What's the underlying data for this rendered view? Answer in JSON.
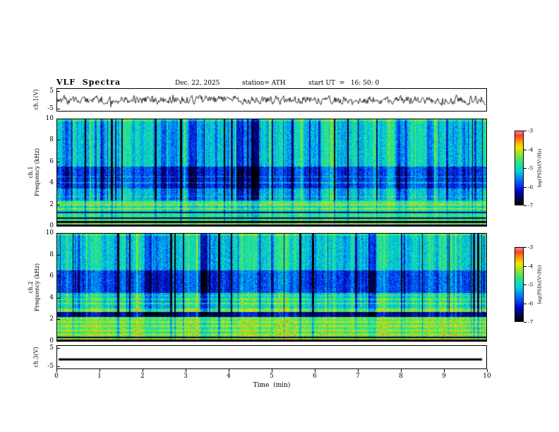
{
  "colors": {
    "background": "#ffffff",
    "ink": "#000000"
  },
  "header": {
    "title": "VLF  Spectra",
    "date": "Dec. 22, 2025",
    "station": "station= ATH",
    "start_ut": "start UT  =   16: 50: 0"
  },
  "panels": {
    "ch1_wave": {
      "label": "ch.1(V)",
      "ymax": "5",
      "ymin": "-5"
    },
    "ch1_spec": {
      "label_line1": "ch.1",
      "label_line2": "Frequency  (kHz)",
      "yticks": [
        "10",
        "8",
        "6",
        "4",
        "2",
        "0"
      ]
    },
    "ch2_spec": {
      "label_line1": "ch.2",
      "label_line2": "Frequency  (kHz)",
      "yticks": [
        "10",
        "8",
        "6",
        "4",
        "2",
        "0"
      ]
    },
    "ch3_wave": {
      "label": "ch.3(V)",
      "ymax": "5",
      "ymin": "-5"
    }
  },
  "xaxis": {
    "label": "Time  (min)",
    "ticks": [
      "0",
      "1",
      "2",
      "3",
      "4",
      "5",
      "6",
      "7",
      "8",
      "9",
      "10"
    ]
  },
  "colorbar": {
    "label": "log(PSD)/(V²/Hz)",
    "ticks": [
      "-3",
      "-4",
      "-5",
      "-6",
      "-7"
    ],
    "gradient": [
      {
        "t": 0.0,
        "hex": "#000000"
      },
      {
        "t": 0.08,
        "hex": "#04044a"
      },
      {
        "t": 0.18,
        "hex": "#0000c8"
      },
      {
        "t": 0.32,
        "hex": "#0064ff"
      },
      {
        "t": 0.46,
        "hex": "#00d2dc"
      },
      {
        "t": 0.58,
        "hex": "#28e682"
      },
      {
        "t": 0.68,
        "hex": "#8ce62c"
      },
      {
        "t": 0.78,
        "hex": "#f0e600"
      },
      {
        "t": 0.87,
        "hex": "#ff9600"
      },
      {
        "t": 0.94,
        "hex": "#ff3c28"
      },
      {
        "t": 1.0,
        "hex": "#ff82a0"
      }
    ]
  },
  "chart_data": [
    {
      "type": "line",
      "title": "ch.1 voltage waveform",
      "xlabel": "Time (min)",
      "ylabel": "ch.1(V)",
      "xlim": [
        0,
        10
      ],
      "ylim": [
        -5,
        5
      ],
      "description": "Continuous noisy broadband signal fluctuating about 0 V, typical excursions ±1–2 V with occasional spikes to about ±3 V over the full 10 minutes."
    },
    {
      "type": "heatmap",
      "title": "ch.1 VLF spectrogram",
      "xlabel": "Time (min)",
      "ylabel": "Frequency (kHz)",
      "xlim": [
        0,
        10
      ],
      "ylim": [
        0,
        10
      ],
      "zlabel": "log(PSD)/(V²/Hz)",
      "zlim": [
        -7,
        -3
      ],
      "noise_sigma": 0.4,
      "profile": [
        {
          "f_range": [
            0,
            0.1
          ],
          "level": -6.8
        },
        {
          "f_range": [
            0.1,
            0.22
          ],
          "level": -4.2
        },
        {
          "f_range": [
            0.22,
            0.45
          ],
          "level": -6.9
        },
        {
          "f_range": [
            0.45,
            0.62
          ],
          "level": -4.6
        },
        {
          "f_range": [
            0.62,
            0.78
          ],
          "level": -6.7
        },
        {
          "f_range": [
            0.78,
            1.15
          ],
          "level": -4.7
        },
        {
          "f_range": [
            1.15,
            1.3
          ],
          "level": -6.4
        },
        {
          "f_range": [
            1.3,
            2.4
          ],
          "level": -4.9
        },
        {
          "f_range": [
            2.4,
            3.5
          ],
          "level": -5.3
        },
        {
          "f_range": [
            3.5,
            5.6
          ],
          "level": -5.9
        },
        {
          "f_range": [
            5.6,
            9.85
          ],
          "level": -5.15
        },
        {
          "f_range": [
            9.85,
            10.01
          ],
          "level": -4.7
        }
      ],
      "lines": [
        {
          "f": 1.55,
          "w": 0.07,
          "level": -4.2
        },
        {
          "f": 1.95,
          "w": 0.07,
          "level": -4.1
        },
        {
          "f": 2.15,
          "w": 0.05,
          "level": -4.3
        },
        {
          "f": 2.75,
          "w": 0.05,
          "level": -4.8
        },
        {
          "f": 4.05,
          "w": 0.05,
          "level": -5.35
        },
        {
          "f": 4.6,
          "w": 0.05,
          "level": -5.35
        }
      ],
      "streak_sensitivity": [
        {
          "f_range": [
            0,
            2.4
          ],
          "k": 0.3
        },
        {
          "f_range": [
            2.4,
            10.01
          ],
          "k": 0.78
        }
      ],
      "features": [
        "broadband cyan-green background near log(PSD) = -5",
        "dense dark-blue band between about 3.5 and 5.5 kHz",
        "numerous narrow vertical dark dropouts spanning all frequencies",
        "bright yellow-green horizontal lines below about 2.5 kHz",
        "near-black band below 0.5 kHz with a thin bright line just above 0 kHz"
      ]
    },
    {
      "type": "heatmap",
      "title": "ch.2 VLF spectrogram",
      "xlabel": "Time (min)",
      "ylabel": "Frequency (kHz)",
      "xlim": [
        0,
        10
      ],
      "ylim": [
        0,
        10
      ],
      "zlabel": "log(PSD)/(V²/Hz)",
      "zlim": [
        -7,
        -3
      ],
      "noise_sigma": 0.4,
      "profile": [
        {
          "f_range": [
            0,
            0.08
          ],
          "level": -6.9
        },
        {
          "f_range": [
            0.08,
            0.2
          ],
          "level": -4.0
        },
        {
          "f_range": [
            0.2,
            0.38
          ],
          "level": -6.8
        },
        {
          "f_range": [
            0.38,
            2.25
          ],
          "level": -4.55
        },
        {
          "f_range": [
            2.25,
            2.7
          ],
          "level": -6.4
        },
        {
          "f_range": [
            2.7,
            3.0
          ],
          "level": -4.4
        },
        {
          "f_range": [
            3.0,
            4.45
          ],
          "level": -5.0
        },
        {
          "f_range": [
            4.45,
            6.6
          ],
          "level": -5.85
        },
        {
          "f_range": [
            6.6,
            9.85
          ],
          "level": -5.1
        },
        {
          "f_range": [
            9.85,
            10.01
          ],
          "level": -4.7
        }
      ],
      "lines": [
        {
          "f": 0.55,
          "w": 0.08,
          "level": -3.9
        },
        {
          "f": 0.95,
          "w": 0.07,
          "level": -4.0
        },
        {
          "f": 1.35,
          "w": 0.07,
          "level": -3.95
        },
        {
          "f": 1.75,
          "w": 0.07,
          "level": -4.0
        },
        {
          "f": 2.05,
          "w": 0.06,
          "level": -4.1
        },
        {
          "f": 3.45,
          "w": 0.06,
          "level": -4.4
        },
        {
          "f": 3.9,
          "w": 0.06,
          "level": -4.5
        },
        {
          "f": 4.25,
          "w": 0.05,
          "level": -4.6
        }
      ],
      "streak_sensitivity": [
        {
          "f_range": [
            0,
            2.25
          ],
          "k": 0.35
        },
        {
          "f_range": [
            2.25,
            10.01
          ],
          "k": 0.78
        }
      ],
      "features": [
        "strong yellow-green horizontal banding from about 0.4 to 2.2 kHz",
        "dark band near 2.3-2.7 kHz",
        "dark-blue region between about 4.5 and 6.5 kHz",
        "numerous narrow vertical dark dropouts spanning all frequencies",
        "thin bright line just above 0 kHz"
      ]
    },
    {
      "type": "line",
      "title": "ch.3 voltage waveform",
      "xlabel": "Time (min)",
      "ylabel": "ch.3(V)",
      "xlim": [
        0,
        10
      ],
      "ylim": [
        -5,
        5
      ],
      "value": -1,
      "description": "Flat constant trace near -1 V for the entire record (inactive channel)."
    }
  ]
}
